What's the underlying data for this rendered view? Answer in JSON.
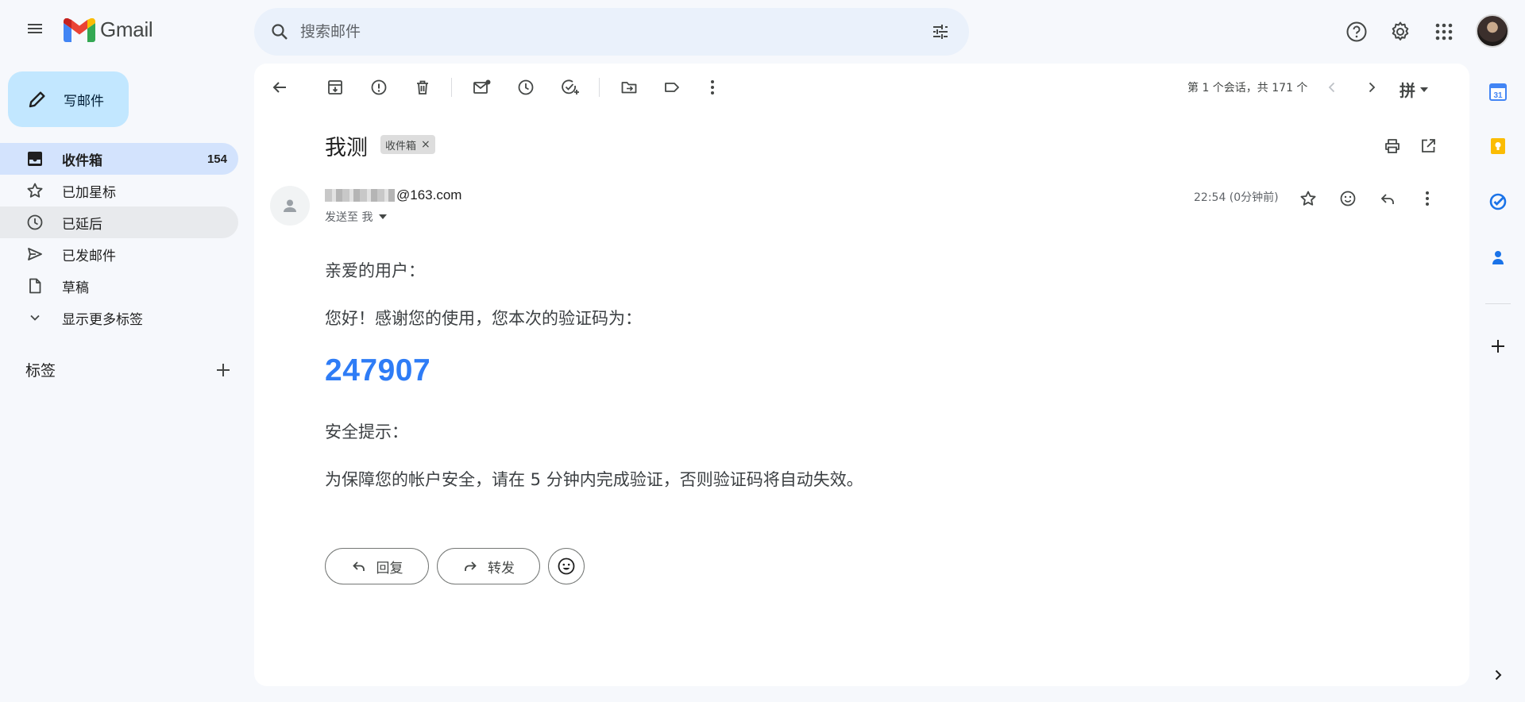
{
  "header": {
    "logo_text": "Gmail",
    "search_placeholder": "搜索邮件"
  },
  "compose": {
    "label": "写邮件"
  },
  "nav": {
    "items": [
      {
        "label": "收件箱",
        "count": "154"
      },
      {
        "label": "已加星标"
      },
      {
        "label": "已延后"
      },
      {
        "label": "已发邮件"
      },
      {
        "label": "草稿"
      },
      {
        "label": "显示更多标签"
      }
    ],
    "labels_heading": "标签"
  },
  "toolbar": {
    "pager_text": "第 1 个会话，共 171 个",
    "input_method": "拼"
  },
  "email": {
    "subject": "我测",
    "chip_label": "收件箱",
    "chip_close": "×",
    "sender_domain": "@163.com",
    "to_label": "发送至 我",
    "time": "22:54 (0分钟前)",
    "greeting": "亲爱的用户：",
    "intro": "您好！感谢您的使用，您本次的验证码为：",
    "code": "247907",
    "security_heading": "安全提示：",
    "security_text": "为保障您的帐户安全，请在 5 分钟内完成验证，否则验证码将自动失效。",
    "reply_label": "回复",
    "forward_label": "转发"
  },
  "colors": {
    "accent_blue": "#2e7cf6",
    "compose_bg": "#c2e7ff",
    "active_nav_bg": "#d3e3fd",
    "page_bg": "#f6f8fc"
  }
}
